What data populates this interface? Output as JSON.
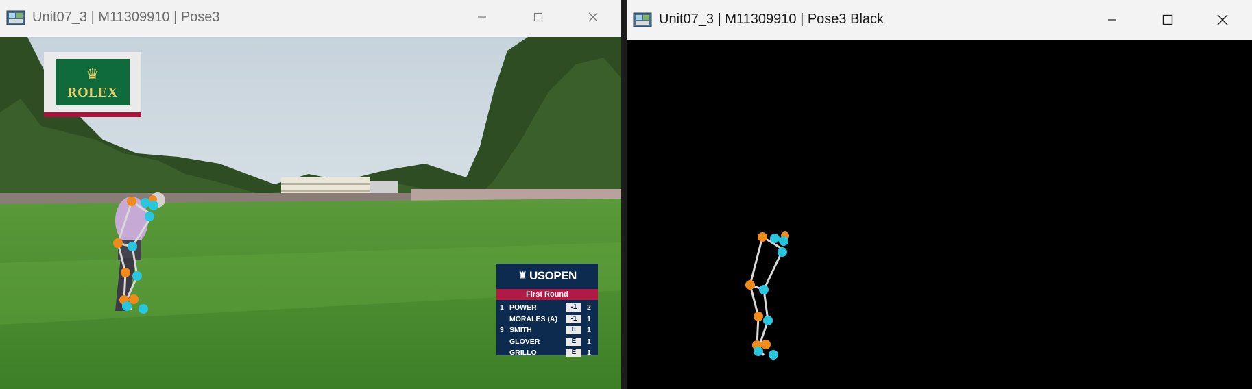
{
  "left_window": {
    "title": "Unit07_3 | M11309910 | Pose3",
    "controls": {
      "minimize": "minimize",
      "maximize": "maximize",
      "close": "close"
    },
    "overlay": {
      "sponsor_logo": "ROLEX",
      "scoreboard": {
        "logo": "USOPEN",
        "round": "First Round",
        "rows": [
          {
            "pos": "1",
            "name": "POWER",
            "score": "-1",
            "thru": "2"
          },
          {
            "pos": "",
            "name": "MORALES (A)",
            "score": "-1",
            "thru": "1"
          },
          {
            "pos": "3",
            "name": "SMITH",
            "score": "E",
            "thru": "1"
          },
          {
            "pos": "",
            "name": "GLOVER",
            "score": "E",
            "thru": "1"
          },
          {
            "pos": "",
            "name": "GRILLO",
            "score": "E",
            "thru": "1"
          }
        ]
      }
    }
  },
  "right_window": {
    "title": "Unit07_3 | M11309910 | Pose3 Black",
    "controls": {
      "minimize": "minimize",
      "maximize": "maximize",
      "close": "close"
    }
  },
  "colors": {
    "keypoint_left": "#f28a1a",
    "keypoint_right": "#29c6e0",
    "skeleton_line": "#d8d8d8",
    "scoreboard_bg": "#0d2a4f",
    "scoreboard_accent": "#b01a44"
  }
}
